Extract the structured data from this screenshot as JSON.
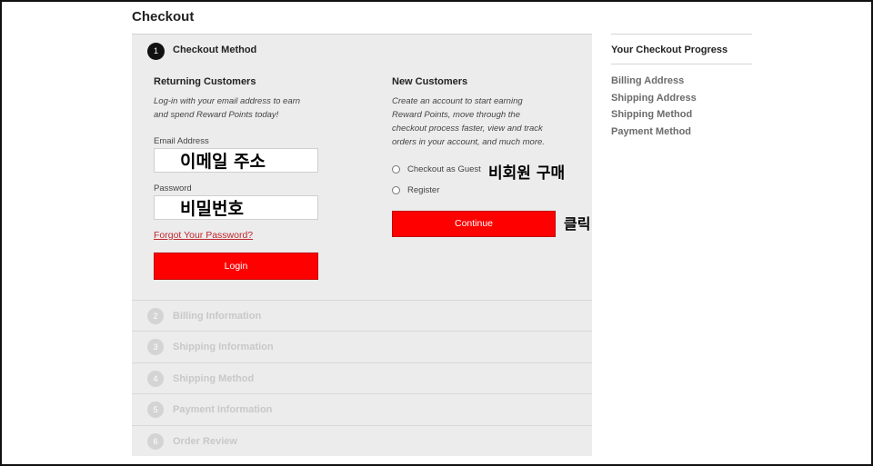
{
  "page": {
    "title": "Checkout"
  },
  "active_step": {
    "number": "1",
    "title": "Checkout Method",
    "returning": {
      "heading": "Returning Customers",
      "desc_line1": "Log-in with your email address to earn",
      "desc_line2": "and spend Reward Points today!",
      "email_label": "Email Address",
      "email_value": "이메일 주소",
      "password_label": "Password",
      "password_value": "비밀번호",
      "forgot_link": "Forgot Your Password?",
      "login_button": "Login"
    },
    "new_customers": {
      "heading": "New Customers",
      "desc_line1": "Create an account to start earning",
      "desc_line2": "Reward Points, move through the",
      "desc_line3": "checkout process faster, view and track",
      "desc_line4": "orders in your account, and much more.",
      "option_guest": "Checkout as Guest",
      "option_register": "Register",
      "continue_button": "Continue"
    }
  },
  "annotations": {
    "guest": "비회원 구매",
    "click": "클릭"
  },
  "steps": [
    {
      "number": "2",
      "label": "Billing Information"
    },
    {
      "number": "3",
      "label": "Shipping Information"
    },
    {
      "number": "4",
      "label": "Shipping Method"
    },
    {
      "number": "5",
      "label": "Payment Information"
    },
    {
      "number": "6",
      "label": "Order Review"
    }
  ],
  "sidebar": {
    "title": "Your Checkout Progress",
    "items": [
      "Billing Address",
      "Shipping Address",
      "Shipping Method",
      "Payment Method"
    ]
  },
  "colors": {
    "accent": "#ff0000",
    "link": "#c0262d",
    "panel": "#ececec"
  }
}
